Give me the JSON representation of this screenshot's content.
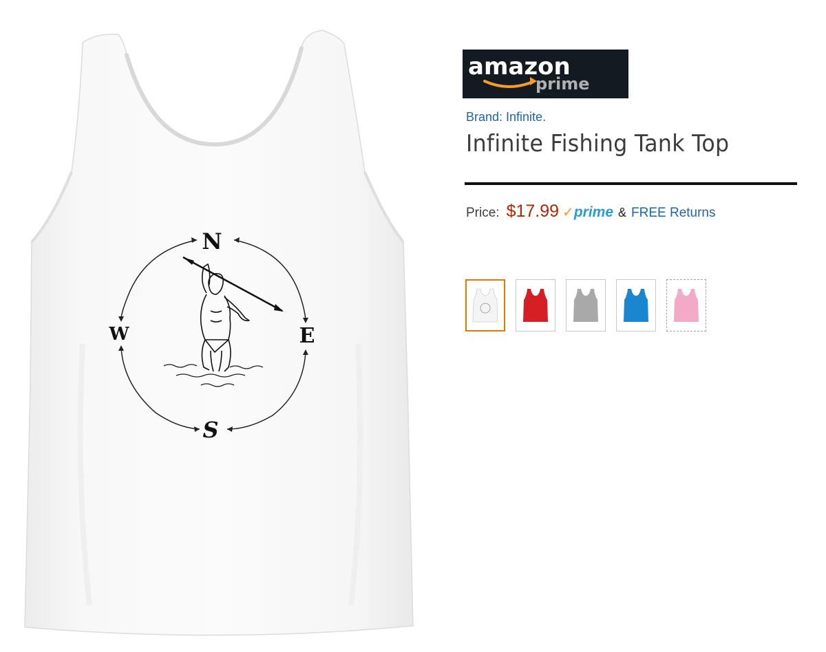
{
  "product_image": {
    "compass_letters": {
      "north": "N",
      "south": "S",
      "east": "E",
      "west": "W"
    }
  },
  "logo": {
    "wordmark": "amazon",
    "subtext": "prime",
    "background": "#131a22",
    "smile_color": "#f79b29"
  },
  "brand": {
    "label": "Brand: Infinite."
  },
  "title": "Infinite Fishing Tank Top",
  "price": {
    "label": "Price:",
    "value": "$17.99",
    "prime_check": "✓",
    "prime_label": "prime",
    "ampersand": "&",
    "returns": "FREE Returns"
  },
  "colors": {
    "link": "#1e64a8",
    "price": "#b12704",
    "prime_blue": "#2b9ad5",
    "selected_border": "#e77600"
  },
  "swatches": [
    {
      "name": "white",
      "color": "#f4f4f4",
      "selected": true
    },
    {
      "name": "red",
      "color": "#d41f25",
      "selected": false
    },
    {
      "name": "gray",
      "color": "#a9a9a9",
      "selected": false
    },
    {
      "name": "blue",
      "color": "#1b86d0",
      "selected": false
    },
    {
      "name": "pink",
      "color": "#f3aac6",
      "selected": false
    }
  ]
}
